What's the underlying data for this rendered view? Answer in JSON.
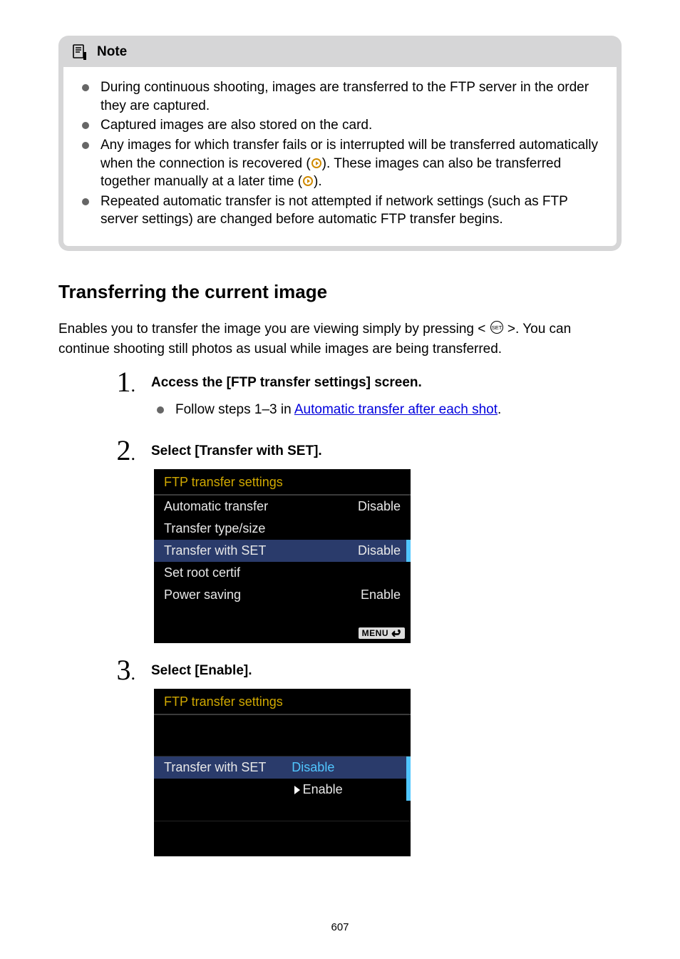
{
  "note": {
    "title": "Note",
    "bullets": {
      "b1": "During continuous shooting, images are transferred to the FTP server in the order they are captured.",
      "b2": "Captured images are also stored on the card.",
      "b3a": "Any images for which transfer fails or is interrupted will be transferred automatically when the connection is recovered (",
      "b3b": "). These images can also be transferred together manually at a later time (",
      "b3c": ").",
      "b4": "Repeated automatic transfer is not attempted if network settings (such as FTP server settings) are changed before automatic FTP transfer begins."
    }
  },
  "heading": "Transferring the current image",
  "intro": {
    "a": "Enables you to transfer the image you are viewing simply by pressing < ",
    "b": " >. You can continue shooting still photos as usual while images are being transferred."
  },
  "steps": {
    "s1": {
      "num": "1",
      "title": "Access the [FTP transfer settings] screen.",
      "bullet_pre": "Follow steps 1–3 in ",
      "bullet_link": "Automatic transfer after each shot",
      "bullet_post": "."
    },
    "s2": {
      "num": "2",
      "title": "Select [Transfer with SET].",
      "screen": {
        "title": "FTP transfer settings",
        "r1l": "Automatic transfer",
        "r1v": "Disable",
        "r2l": "Transfer type/size",
        "r3l": "Transfer with SET",
        "r3v": "Disable",
        "r4l": "Set root certif",
        "r5l": "Power saving",
        "r5v": "Enable",
        "menu": "MENU"
      }
    },
    "s3": {
      "num": "3",
      "title": "Select [Enable].",
      "screen": {
        "title": "FTP transfer settings",
        "rowl": "Transfer with SET",
        "opt1": "Disable",
        "opt2": "Enable"
      }
    }
  },
  "page_number": "607"
}
